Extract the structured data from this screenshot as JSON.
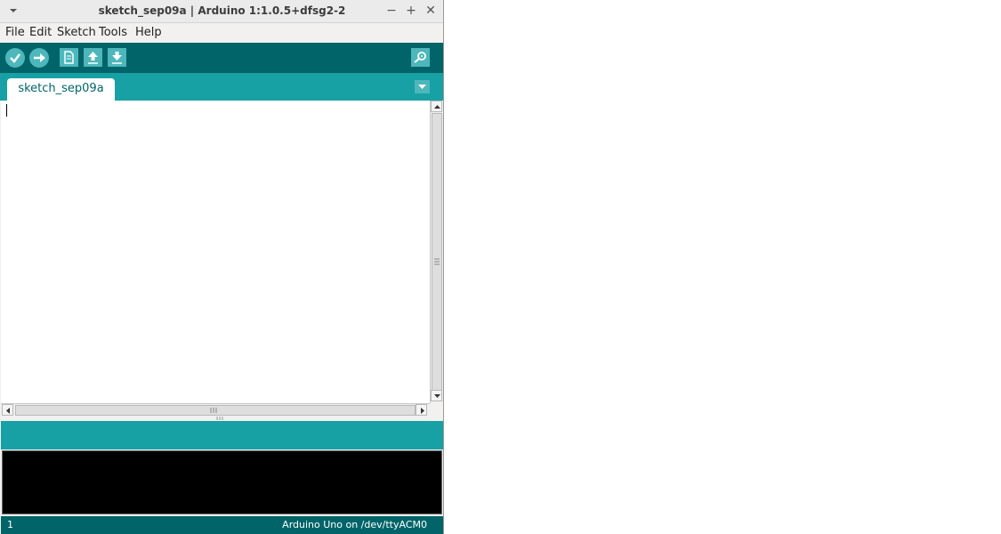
{
  "window": {
    "title": "sketch_sep09a | Arduino 1:1.0.5+dfsg2-2",
    "controls": {
      "minimize": "−",
      "maximize": "+",
      "close": "✕"
    }
  },
  "menu": [
    "File",
    "Edit",
    "Sketch",
    "Tools",
    "Help"
  ],
  "toolbar": {
    "buttons": [
      "verify-icon",
      "upload-icon",
      "new-icon",
      "open-icon",
      "save-icon"
    ],
    "right_button": "serial-monitor-icon"
  },
  "tabs": [
    {
      "label": "sketch_sep09a"
    }
  ],
  "editor": {
    "content": ""
  },
  "status": {
    "line": "1",
    "board": "Arduino Uno on /dev/ttyACM0"
  },
  "colors": {
    "toolbar": "#006468",
    "tabbar": "#17a1a5",
    "button": "#4db7bb",
    "console": "#000000"
  }
}
